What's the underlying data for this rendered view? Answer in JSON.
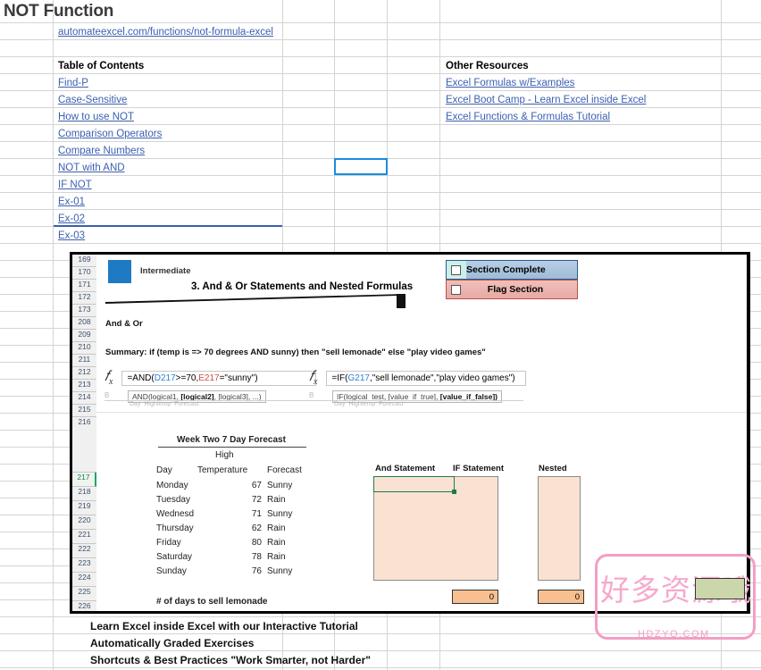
{
  "app": {
    "type": "excel-worksheet"
  },
  "sheet": {
    "title": "NOT Function",
    "url_link": "automateexcel.com/functions/not-formula-excel",
    "toc_header": "Table of Contents",
    "toc_links": [
      "Find-P",
      "Case-Sensitive",
      "How to use NOT",
      "Comparison Operators",
      "Compare Numbers",
      "NOT with AND",
      "IF NOT",
      "Ex-01",
      "Ex-02",
      "Ex-03"
    ],
    "resources_header": "Other Resources",
    "resources_links": [
      "Excel Formulas w/Examples",
      "Excel Boot Camp - Learn Excel inside Excel",
      "Excel Functions & Formulas Tutorial"
    ],
    "footer_lines": [
      "Learn Excel inside Excel with our Interactive Tutorial",
      "Automatically Graded Exercises",
      "Shortcuts & Best Practices \"Work Smarter, not Harder\""
    ]
  },
  "embedded": {
    "level_badge": "Intermediate",
    "lesson_title": "3. And & Or Statements and Nested Formulas",
    "section_label": "And & Or",
    "summary": "Summary: if (temp is => 70 degrees AND sunny) then \"sell lemonade\" else \"play video games\"",
    "section_complete_label": "Section Complete",
    "flag_section_label": "Flag Section",
    "row_numbers": [
      "169",
      "170",
      "171",
      "172",
      "173",
      "208",
      "209",
      "210",
      "211",
      "212",
      "213",
      "214",
      "215",
      "216",
      "217",
      "218",
      "219",
      "220",
      "221",
      "222",
      "223",
      "224",
      "225",
      "226"
    ],
    "formula_left": {
      "prefix": "=AND(",
      "ref1": "D217",
      "mid": ">=70,",
      "ref2": "E217",
      "suffix": "=\"sunny\")",
      "full": "=AND(D217>=70,E217=\"sunny\")",
      "tooltip_plain_1": "AND(logical1, ",
      "tooltip_bold": "[logical2]",
      "tooltip_plain_2": ", [logical3], ...)",
      "col_letter": "B"
    },
    "formula_right": {
      "prefix": "=IF(",
      "ref1": "G217",
      "suffix": ",\"sell lemonade\",\"play video games\")",
      "full": "=IF(G217,\"sell lemonade\",\"play video games\")",
      "tooltip_plain_1": "IF(logical_test, [value_if_true], ",
      "tooltip_bold": "[value_if_false])",
      "col_letter": "B"
    },
    "forecast": {
      "title": "Week Two 7 Day Forecast",
      "sub_header": "High",
      "columns": [
        "Day",
        "Temperature",
        "Forecast"
      ],
      "rows": [
        {
          "day": "Monday",
          "temp": "67",
          "forecast": "Sunny"
        },
        {
          "day": "Tuesday",
          "temp": "72",
          "forecast": "Rain"
        },
        {
          "day": "Wednesd",
          "temp": "71",
          "forecast": "Sunny"
        },
        {
          "day": "Thursday",
          "temp": "62",
          "forecast": "Rain"
        },
        {
          "day": "Friday",
          "temp": "80",
          "forecast": "Rain"
        },
        {
          "day": "Saturday",
          "temp": "78",
          "forecast": "Rain"
        },
        {
          "day": "Sunday",
          "temp": "76",
          "forecast": "Sunny"
        }
      ],
      "totals_label": "# of days to sell lemonade"
    },
    "statements": {
      "and_label": "And Statement",
      "if_label": "IF Statement",
      "nested_label": "Nested",
      "if_total": "0",
      "nested_total": "0"
    }
  },
  "watermark": {
    "text": "好多资源哦",
    "domain": "HDZYO.COM",
    "color": "#f6a9cc"
  }
}
